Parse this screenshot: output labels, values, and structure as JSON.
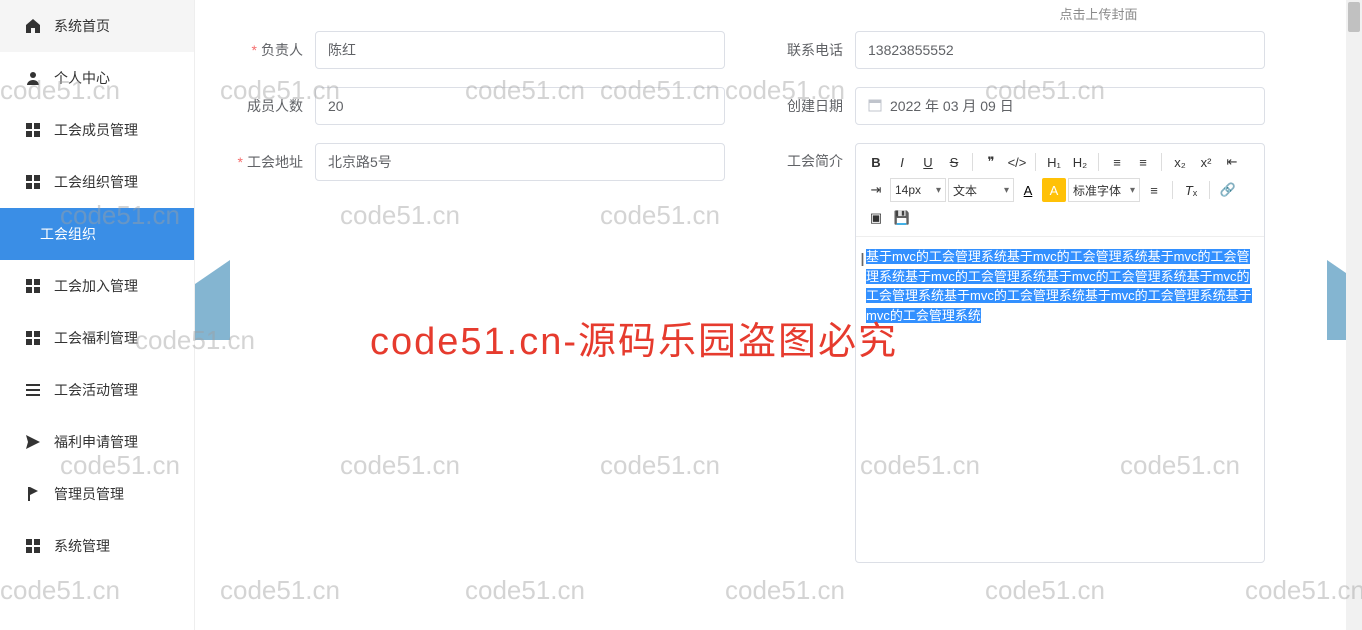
{
  "sidebar": {
    "items": [
      {
        "label": "系统首页",
        "icon": "home"
      },
      {
        "label": "个人中心",
        "icon": "user"
      },
      {
        "label": "工会成员管理",
        "icon": "grid"
      },
      {
        "label": "工会组织管理",
        "icon": "grid"
      },
      {
        "label": "工会组织",
        "icon": "",
        "sub": true,
        "active": true
      },
      {
        "label": "工会加入管理",
        "icon": "grid"
      },
      {
        "label": "工会福利管理",
        "icon": "grid"
      },
      {
        "label": "工会活动管理",
        "icon": "list"
      },
      {
        "label": "福利申请管理",
        "icon": "send"
      },
      {
        "label": "管理员管理",
        "icon": "flag"
      },
      {
        "label": "系统管理",
        "icon": "grid"
      }
    ]
  },
  "upload_hint": "点击上传封面",
  "form": {
    "fuzeren": {
      "label": "负责人",
      "value": "陈红",
      "required": true
    },
    "lianxi": {
      "label": "联系电话",
      "value": "13823855552"
    },
    "renshu": {
      "label": "成员人数",
      "value": "20"
    },
    "riqi": {
      "label": "创建日期",
      "value": "2022 年 03 月 09 日"
    },
    "dizhi": {
      "label": "工会地址",
      "value": "北京路5号",
      "required": true
    },
    "jianjie": {
      "label": "工会简介"
    }
  },
  "editor": {
    "toolbar": {
      "font_size": "14px",
      "text_style": "文本",
      "font_family": "标准字体"
    },
    "content": "基于mvc的工会管理系统基于mvc的工会管理系统基于mvc的工会管理系统基于mvc的工会管理系统基于mvc的工会管理系统基于mvc的工会管理系统基于mvc的工会管理系统基于mvc的工会管理系统基于mvc的工会管理系统"
  },
  "watermarks": {
    "text": "code51.cn",
    "big": "code51.cn-源码乐园盗图必究"
  }
}
